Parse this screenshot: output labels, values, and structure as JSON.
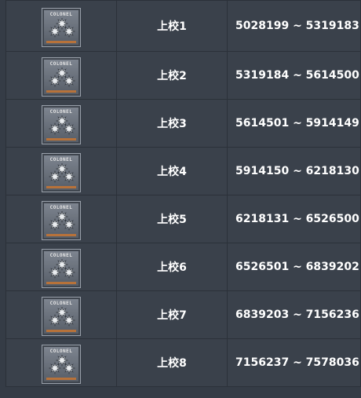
{
  "ranks": [
    {
      "badge_text": "COLONEL",
      "badge_icon": "colonel-stars-icon",
      "name": "上校1",
      "range": "5028199 ~ 5319183"
    },
    {
      "badge_text": "COLONEL",
      "badge_icon": "colonel-stars-icon",
      "name": "上校2",
      "range": "5319184 ~ 5614500"
    },
    {
      "badge_text": "COLONEL",
      "badge_icon": "colonel-stars-icon",
      "name": "上校3",
      "range": "5614501 ~ 5914149"
    },
    {
      "badge_text": "COLONEL",
      "badge_icon": "colonel-stars-icon",
      "name": "上校4",
      "range": "5914150 ~ 6218130"
    },
    {
      "badge_text": "COLONEL",
      "badge_icon": "colonel-stars-icon",
      "name": "上校5",
      "range": "6218131 ~ 6526500"
    },
    {
      "badge_text": "COLONEL",
      "badge_icon": "colonel-stars-icon",
      "name": "上校6",
      "range": "6526501 ~ 6839202"
    },
    {
      "badge_text": "COLONEL",
      "badge_icon": "colonel-stars-icon",
      "name": "上校7",
      "range": "6839203 ~ 7156236"
    },
    {
      "badge_text": "COLONEL",
      "badge_icon": "colonel-stars-icon",
      "name": "上校8",
      "range": "7156237 ~ 7578036"
    }
  ],
  "colors": {
    "background": "#353c46",
    "table_bg": "#3a414b",
    "border": "#2b3139",
    "text": "#ffffff",
    "badge_accent": "#b7723a"
  }
}
